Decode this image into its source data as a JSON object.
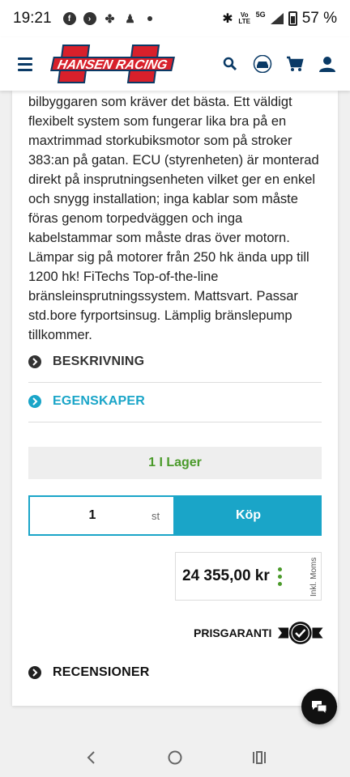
{
  "status_bar": {
    "time": "19:21",
    "battery": "57 %",
    "network": "5G",
    "volte": "Vo LTE"
  },
  "header": {
    "logo_text": "HANSEN RACING",
    "icons": [
      "menu-icon",
      "search-icon",
      "car-icon",
      "cart-icon",
      "account-icon"
    ]
  },
  "product": {
    "description_lines": [
      "bilbyggaren som kräver det bästa. Ett väldigt",
      "flexibelt system som fungerar lika bra på en",
      "maxtrimmad storkubiksmotor som på stroker",
      "383:an på gatan. ECU (styrenheten) är monterad",
      "direkt på insprutningsenheten vilket ger en enkel",
      "och snygg installation; inga kablar som måste",
      "föras genom torpedväggen och inga",
      "kabelstammar som måste dras över motorn.",
      "Lämpar sig på motorer från 250 hk ända upp till",
      "1200 hk! FiTechs Top-of-the-line",
      "bränsleinsprutningssystem. Mattsvart. Passar",
      "std.bore fyrportsinsug. Lämplig bränslepump",
      "tillkommer."
    ],
    "sections": {
      "description": "BESKRIVNING",
      "features": "EGENSKAPER",
      "reviews": "RECENSIONER"
    },
    "stock": "1 I Lager",
    "quantity": "1",
    "unit": "st",
    "buy_label": "Köp",
    "price": "24 355,00 kr",
    "vat_label": "Inkl. Moms",
    "guarantee": "PRISGARANTI"
  },
  "colors": {
    "accent": "#1aa5c8",
    "stock_green": "#4a9a2a",
    "brand_red": "#d8202b",
    "brand_navy": "#0a3a66"
  }
}
